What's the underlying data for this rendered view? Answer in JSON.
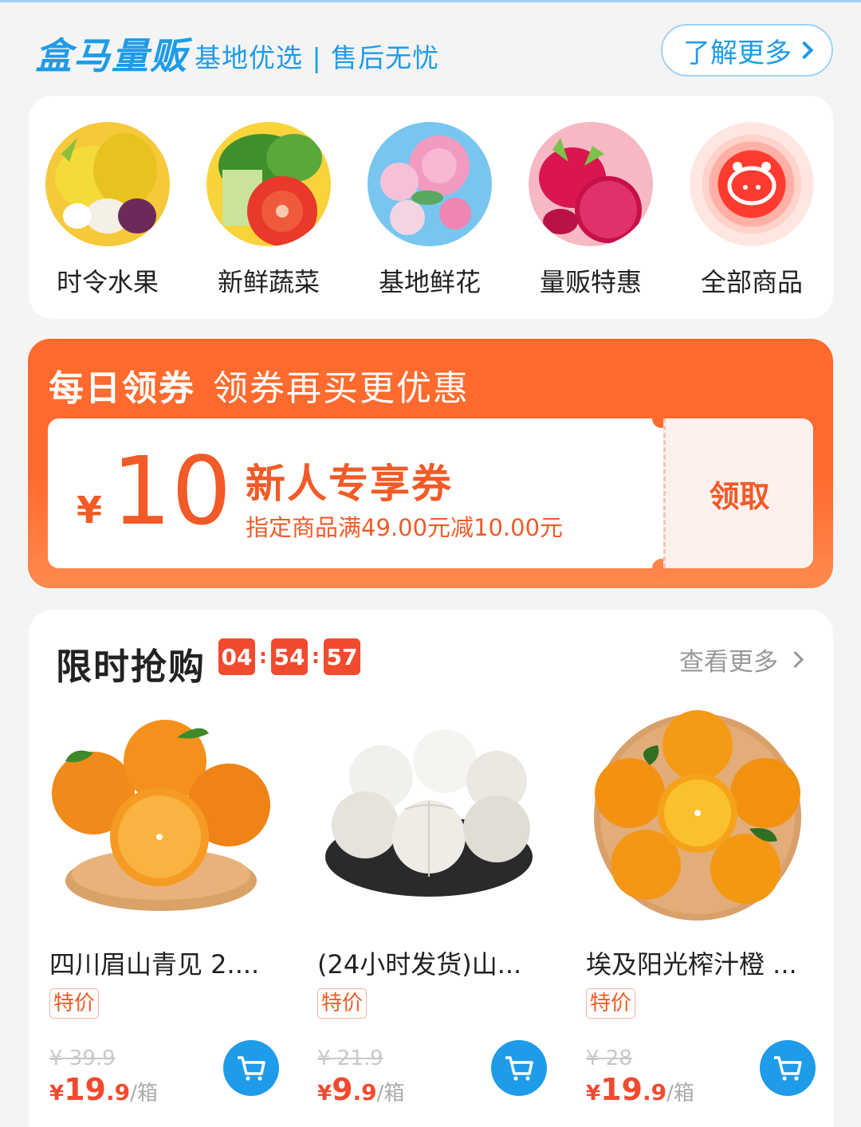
{
  "header": {
    "brand": "盒马量贩",
    "tagline": "基地优选 | 售后无忧",
    "more_label": "了解更多"
  },
  "categories": [
    {
      "label": "时令水果",
      "icon": "fruit-icon"
    },
    {
      "label": "新鲜蔬菜",
      "icon": "vegetable-icon"
    },
    {
      "label": "基地鲜花",
      "icon": "flower-icon"
    },
    {
      "label": "量贩特惠",
      "icon": "dragon-fruit-icon"
    },
    {
      "label": "全部商品",
      "icon": "hippo-icon"
    }
  ],
  "coupon_section": {
    "title": "每日领券",
    "subtitle": "领券再买更优惠",
    "coupon": {
      "currency": "¥",
      "amount": "10",
      "name": "新人专享券",
      "desc": "指定商品满49.00元减10.00元",
      "claim_label": "领取"
    }
  },
  "flash_sale": {
    "title": "限时抢购",
    "timer": {
      "h": "04",
      "m": "54",
      "s": "57"
    },
    "see_more": "查看更多",
    "products": [
      {
        "name": "四川眉山青见 2....",
        "tag": "特价",
        "old_price": "¥ 39.9",
        "currency": "¥",
        "price_int": "19",
        "price_dec": ".9",
        "unit": "/箱"
      },
      {
        "name": "(24小时发货)山...",
        "tag": "特价",
        "old_price": "¥ 21.9",
        "currency": "¥",
        "price_int": "9",
        "price_dec": ".9",
        "unit": "/箱"
      },
      {
        "name": "埃及阳光榨汁橙 ...",
        "tag": "特价",
        "old_price": "¥ 28",
        "currency": "¥",
        "price_int": "19",
        "price_dec": ".9",
        "unit": "/箱"
      }
    ]
  },
  "colors": {
    "brand_blue": "#1e9be9",
    "accent_orange": "#ff6a2e",
    "price_red": "#f14a2f"
  }
}
